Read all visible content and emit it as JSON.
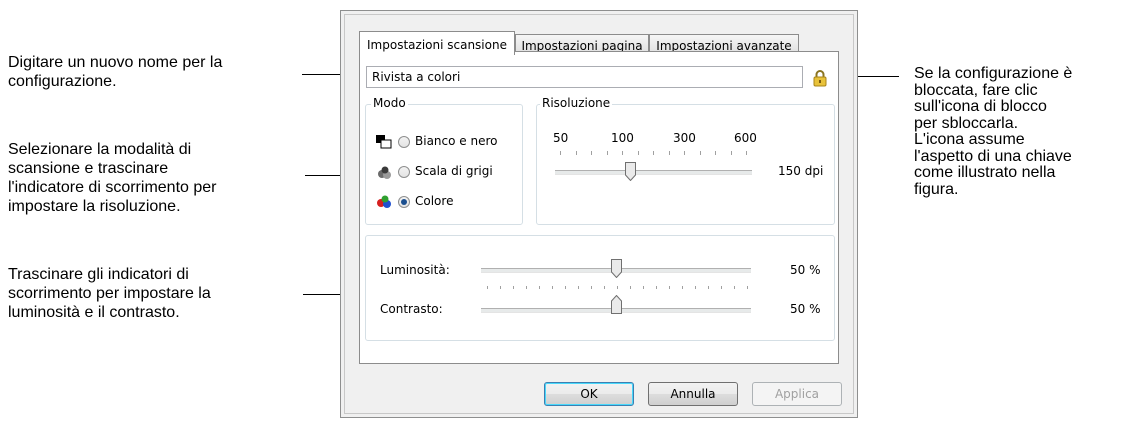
{
  "callouts": {
    "name": [
      "Digitare un nuovo nome per la",
      "configurazione."
    ],
    "mode": [
      "Selezionare la modalità di",
      "scansione e trascinare",
      "l'indicatore di scorrimento per",
      "impostare la risoluzione."
    ],
    "brightness": [
      "Trascinare gli indicatori di",
      "scorrimento per impostare la",
      "luminosità e il contrasto."
    ],
    "lock": [
      "Se la configurazione è",
      "bloccata, fare clic",
      "sull'icona di blocco",
      "per sbloccarla.",
      "L'icona assume",
      "l'aspetto di una chiave",
      "come illustrato nella",
      "figura."
    ]
  },
  "tabs": [
    {
      "label": "Impostazioni scansione",
      "active": true
    },
    {
      "label": "Impostazioni pagina",
      "active": false
    },
    {
      "label": "Impostazioni avanzate",
      "active": false
    }
  ],
  "name_field": {
    "value": "Rivista a colori"
  },
  "lock_icon": "padlock-icon",
  "mode": {
    "label": "Modo",
    "options": [
      {
        "label": "Bianco e nero",
        "icon": "black-white-icon",
        "selected": false
      },
      {
        "label": "Scala di grigi",
        "icon": "grayscale-icon",
        "selected": false
      },
      {
        "label": "Colore",
        "icon": "color-icon",
        "selected": true
      }
    ]
  },
  "resolution": {
    "label": "Risoluzione",
    "scale": [
      "50",
      "100",
      "300",
      "600"
    ],
    "value": "150 dpi",
    "slider_fraction": 0.38
  },
  "adjustments": {
    "brightness": {
      "label": "Luminosità:",
      "value": "50 %",
      "fraction": 0.5
    },
    "contrast": {
      "label": "Contrasto:",
      "value": "50 %",
      "fraction": 0.5
    }
  },
  "buttons": {
    "ok": "OK",
    "cancel": "Annulla",
    "apply": "Applica"
  },
  "colors": {
    "accent": "#3c7fb1",
    "panel_border": "#8c8c8c"
  }
}
